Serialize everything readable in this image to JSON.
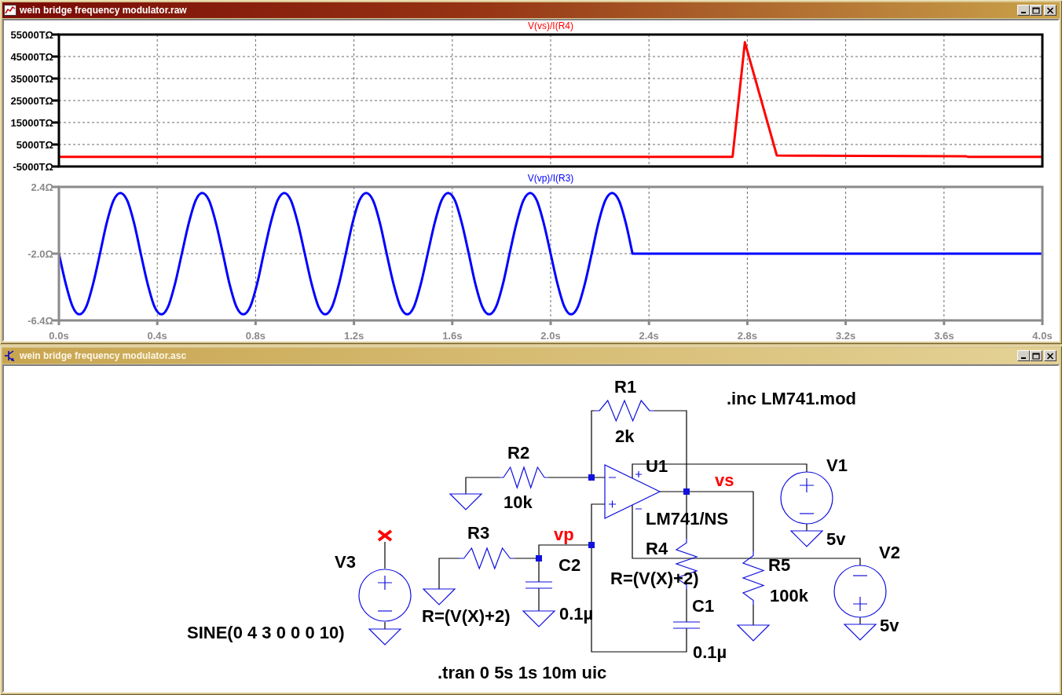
{
  "plot_window": {
    "title": "wein bridge frequency modulator.raw",
    "active": true,
    "panes": [
      {
        "chart_data": {
          "type": "line",
          "title": "V(vs)/I(R4)",
          "grid": true,
          "xlim": [
            0,
            4
          ],
          "ylim": [
            -5000,
            55000
          ],
          "yticks": [
            {
              "value": -5000,
              "label": "-5000TΩ"
            },
            {
              "value": 5000,
              "label": "5000TΩ"
            },
            {
              "value": 15000,
              "label": "15000TΩ"
            },
            {
              "value": 25000,
              "label": "25000TΩ"
            },
            {
              "value": 35000,
              "label": "35000TΩ"
            },
            {
              "value": 45000,
              "label": "45000TΩ"
            },
            {
              "value": 55000,
              "label": "55000TΩ"
            }
          ],
          "x": [
            0,
            2.74,
            2.79,
            2.92,
            3.05,
            3.69,
            3.7,
            4.0
          ],
          "series": [
            {
              "color": "#ff0000",
              "values": [
                -600,
                -600,
                51500,
                0,
                -100,
                -400,
                -600,
                -600
              ]
            }
          ]
        }
      },
      {
        "chart_data": {
          "type": "line",
          "title": "V(vp)/I(R3)",
          "grid": true,
          "xlim": [
            0,
            4
          ],
          "ylim": [
            -6.4,
            2.4
          ],
          "xticks": [
            {
              "value": 0,
              "label": "0.0s"
            },
            {
              "value": 0.4,
              "label": "0.4s"
            },
            {
              "value": 0.8,
              "label": "0.8s"
            },
            {
              "value": 1.2,
              "label": "1.2s"
            },
            {
              "value": 1.6,
              "label": "1.6s"
            },
            {
              "value": 2.0,
              "label": "2.0s"
            },
            {
              "value": 2.4,
              "label": "2.4s"
            },
            {
              "value": 2.8,
              "label": "2.8s"
            },
            {
              "value": 3.2,
              "label": "3.2s"
            },
            {
              "value": 3.6,
              "label": "3.6s"
            },
            {
              "value": 4.0,
              "label": "4.0s"
            }
          ],
          "yticks": [
            {
              "value": -6.4,
              "label": "-6.4Ω"
            },
            {
              "value": -2.0,
              "label": "-2.0Ω"
            },
            {
              "value": 2.4,
              "label": "2.4Ω"
            }
          ],
          "x": [
            0,
            0.028,
            0.056,
            0.083,
            0.111,
            0.139,
            0.167,
            0.194,
            0.222,
            0.25,
            0.278,
            0.306,
            0.333,
            0.361,
            0.389,
            0.417,
            0.444,
            0.472,
            0.5,
            0.528,
            0.556,
            0.583,
            0.611,
            0.639,
            0.667,
            0.694,
            0.722,
            0.75,
            0.778,
            0.806,
            0.833,
            0.861,
            0.889,
            0.917,
            0.944,
            0.972,
            1,
            1.028,
            1.056,
            1.083,
            1.111,
            1.139,
            1.167,
            1.194,
            1.222,
            1.25,
            1.278,
            1.306,
            1.333,
            1.361,
            1.389,
            1.417,
            1.444,
            1.472,
            1.5,
            1.528,
            1.556,
            1.583,
            1.611,
            1.639,
            1.667,
            1.694,
            1.722,
            1.75,
            1.778,
            1.806,
            1.833,
            1.861,
            1.889,
            1.917,
            1.944,
            1.972,
            2,
            2.028,
            2.056,
            2.083,
            2.111,
            2.139,
            2.167,
            2.194,
            2.222,
            2.25,
            2.278,
            2.306,
            2.333,
            4
          ],
          "series": [
            {
              "color": "#0000ff",
              "values": [
                -2,
                -4,
                -5.5,
                -6,
                -5.5,
                -4,
                -2,
                0,
                1.5,
                2,
                1.5,
                0,
                -2,
                -4,
                -5.5,
                -6,
                -5.5,
                -4,
                -2,
                0,
                1.5,
                2,
                1.5,
                0,
                -2,
                -4,
                -5.5,
                -6,
                -5.5,
                -4,
                -2,
                0,
                1.5,
                2,
                1.5,
                0,
                -2,
                -4,
                -5.5,
                -6,
                -5.5,
                -4,
                -2,
                0,
                1.5,
                2,
                1.5,
                0,
                -2,
                -4,
                -5.5,
                -6,
                -5.5,
                -4,
                -2,
                0,
                1.5,
                2,
                1.5,
                0,
                -2,
                -4,
                -5.5,
                -6,
                -5.5,
                -4,
                -2,
                0,
                1.5,
                2,
                1.5,
                0,
                -2,
                -4,
                -5.5,
                -6,
                -5.5,
                -4,
                -2,
                0,
                1.5,
                2,
                1.5,
                0,
                -2,
                -2
              ]
            }
          ]
        }
      }
    ]
  },
  "schematic_window": {
    "title": "wein bridge frequency modulator.asc",
    "active": false,
    "components": [
      {
        "kind": "resistor",
        "ref": "R1",
        "value": "2k"
      },
      {
        "kind": "resistor",
        "ref": "R2",
        "value": "10k"
      },
      {
        "kind": "resistor",
        "ref": "R3",
        "value": "R=(V(X)+2)"
      },
      {
        "kind": "resistor",
        "ref": "R4",
        "value": "R=(V(X)+2)"
      },
      {
        "kind": "resistor",
        "ref": "R5",
        "value": "100k"
      },
      {
        "kind": "capacitor",
        "ref": "C1",
        "value": "0.1µ"
      },
      {
        "kind": "capacitor",
        "ref": "C2",
        "value": "0.1µ"
      },
      {
        "kind": "source",
        "ref": "V1",
        "value": "5v"
      },
      {
        "kind": "source",
        "ref": "V2",
        "value": "5v"
      },
      {
        "kind": "source",
        "ref": "V3",
        "value": "SINE(0 4 3 0 0 0 10)"
      },
      {
        "kind": "opamp",
        "ref": "U1",
        "value": "LM741/NS"
      }
    ],
    "net_labels": [
      "vp",
      "vs"
    ],
    "directives": [
      ".inc LM741.mod",
      ".tran 0 5s 1s 10m uic"
    ]
  }
}
